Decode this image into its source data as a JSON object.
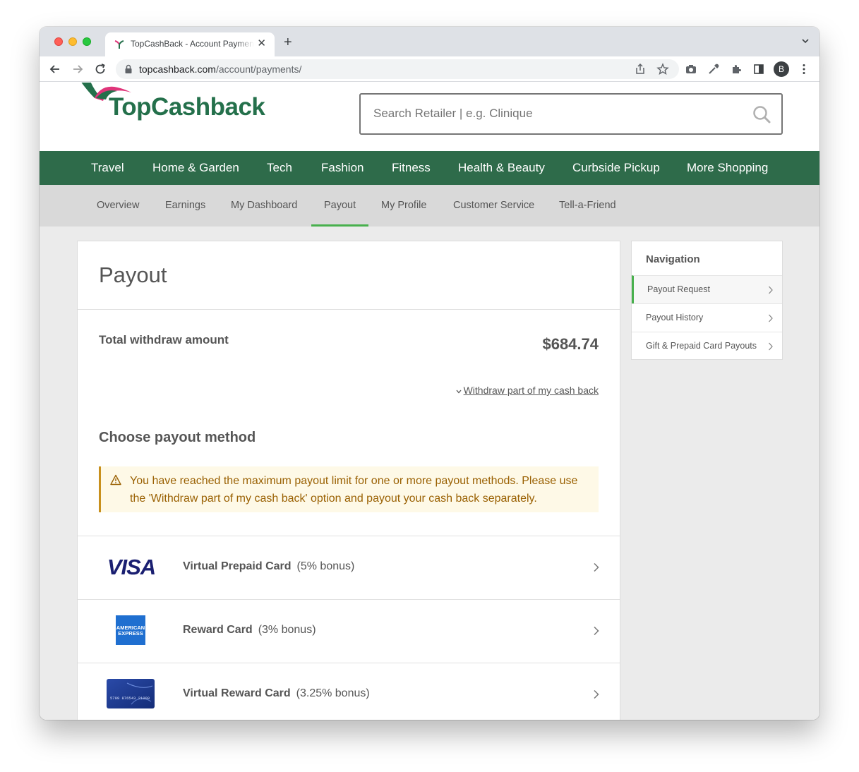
{
  "browser": {
    "tab_title": "TopCashBack - Account Payments",
    "url_host": "topcashback.com",
    "url_path": "/account/payments/",
    "profile_initial": "B"
  },
  "site": {
    "logo_text": "TopCashback",
    "search_placeholder": "Search Retailer | e.g. Clinique",
    "brand_color": "#2e6b4a",
    "accent_color": "#48b04d"
  },
  "main_nav": [
    "Travel",
    "Home & Garden",
    "Tech",
    "Fashion",
    "Fitness",
    "Health & Beauty",
    "Curbside Pickup",
    "More Shopping"
  ],
  "sub_nav": {
    "items": [
      "Overview",
      "Earnings",
      "My Dashboard",
      "Payout",
      "My Profile",
      "Customer Service",
      "Tell-a-Friend"
    ],
    "active": "Payout"
  },
  "payout": {
    "title": "Payout",
    "total_label": "Total withdraw amount",
    "total_value": "$684.74",
    "withdraw_link": "Withdraw part of my cash back",
    "choose_title": "Choose payout method",
    "warning": "You have reached the maximum payout limit for one or more payout methods. Please use the 'Withdraw part of my cash back' option and payout your cash back separately.",
    "methods": [
      {
        "name": "Virtual Prepaid Card",
        "bonus": "(5% bonus)",
        "logo": "visa-logo"
      },
      {
        "name": "Reward Card",
        "bonus": "(3% bonus)",
        "logo": "amex-logo"
      },
      {
        "name": "Virtual Reward Card",
        "bonus": "(3.25% bonus)",
        "logo": "card-logo"
      }
    ]
  },
  "sidebar": {
    "title": "Navigation",
    "items": [
      {
        "label": "Payout Request",
        "active": true
      },
      {
        "label": "Payout History",
        "active": false
      },
      {
        "label": "Gift & Prepaid Card Payouts",
        "active": false
      }
    ]
  },
  "amex_lettering": [
    "AMERICAN",
    "EXPRESS"
  ],
  "card_lettering": "5799 876543 21000"
}
